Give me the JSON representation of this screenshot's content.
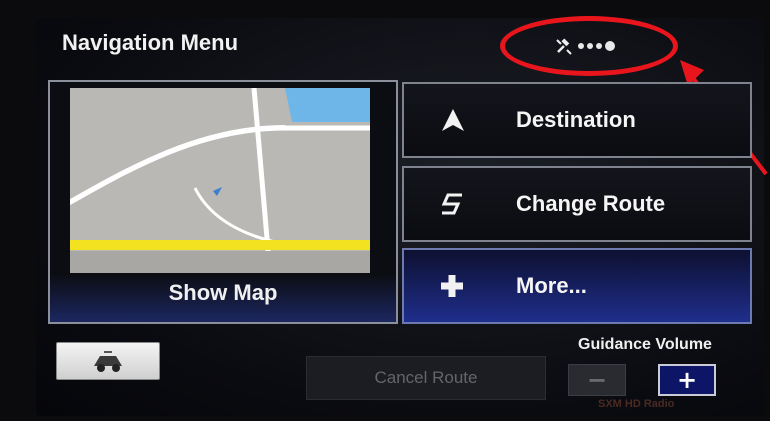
{
  "header": {
    "title": "Navigation Menu"
  },
  "status": {
    "gps_signal_icon": "satellite-signal-icon"
  },
  "map_panel": {
    "label": "Show Map"
  },
  "menu": {
    "items": [
      {
        "label": "Destination",
        "icon": "navigation-arrow-icon"
      },
      {
        "label": "Change Route",
        "icon": "route-s-icon"
      },
      {
        "label": "More...",
        "icon": "plus-icon"
      }
    ]
  },
  "footer": {
    "cancel_route_label": "Cancel Route",
    "guidance_volume_label": "Guidance Volume",
    "volume_down_label": "−",
    "volume_up_label": "+",
    "logos_text": "SXM  HD Radio"
  },
  "colors": {
    "annotation": "#e8161c",
    "selected_blue": "#1f2e8c",
    "map_road_yellow": "#f3e21f",
    "map_water_blue": "#6fb6e8"
  }
}
